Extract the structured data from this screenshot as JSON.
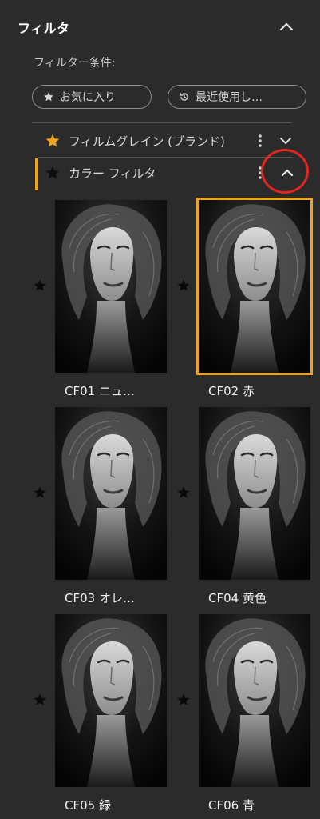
{
  "header": {
    "title": "フィルタ"
  },
  "conditions": {
    "label": "フィルター条件:",
    "chips": [
      {
        "label": "お気に入り",
        "icon": "star-icon"
      },
      {
        "label": "最近使用し…",
        "icon": "history-icon"
      }
    ]
  },
  "groups": [
    {
      "label": "フィルムグレイン (ブランド)",
      "favorite": true,
      "expanded": false
    },
    {
      "label": "カラー フィルタ",
      "favorite": false,
      "expanded": true
    }
  ],
  "presets": [
    {
      "name": "CF01 ニュ…",
      "selected": false
    },
    {
      "name": "CF02 赤",
      "selected": true
    },
    {
      "name": "CF03 オレ…",
      "selected": false
    },
    {
      "name": "CF04 黄色",
      "selected": false
    },
    {
      "name": "CF05 緑",
      "selected": false
    },
    {
      "name": "CF06 青",
      "selected": false
    }
  ],
  "colors": {
    "accent": "#f0a41a",
    "annotation": "#e2251f",
    "background": "#2b2b2b"
  }
}
